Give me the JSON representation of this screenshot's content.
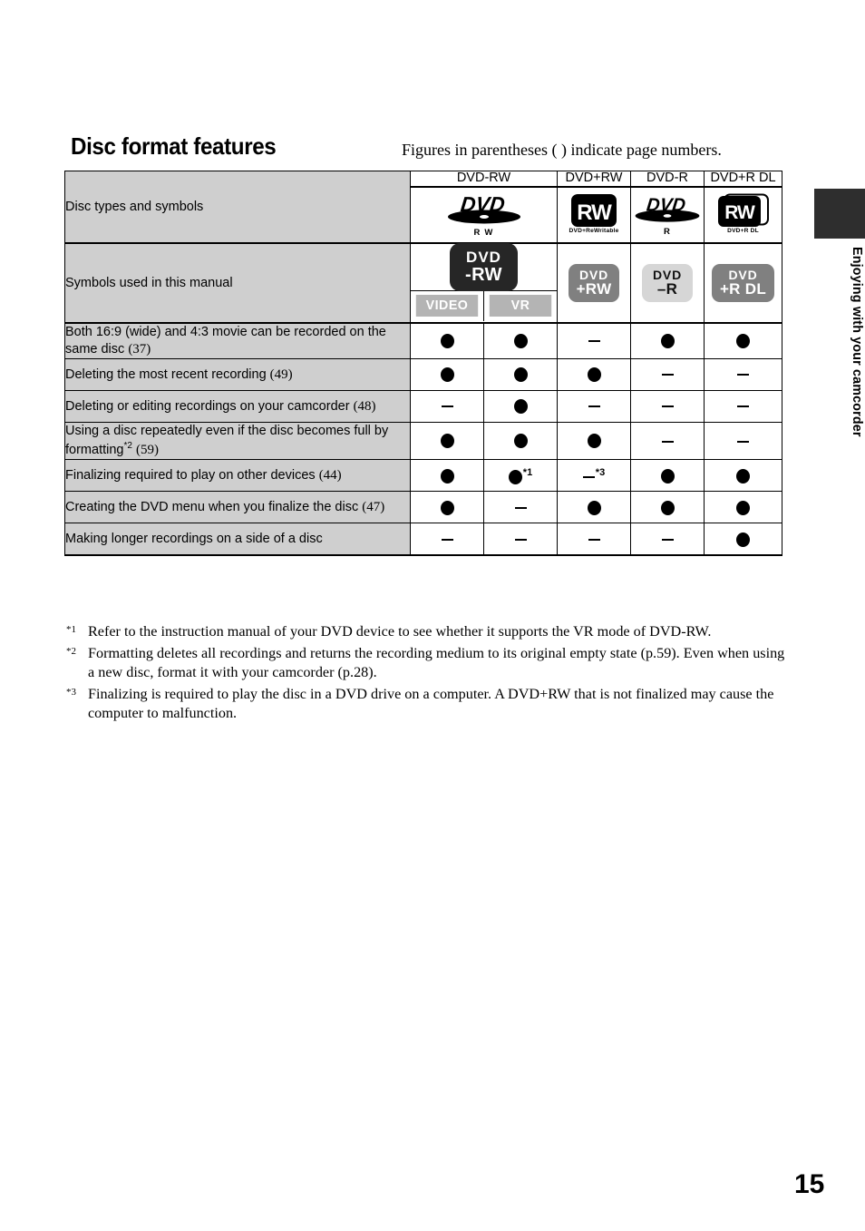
{
  "page": {
    "title": "Disc format features",
    "note": "Figures in parentheses ( ) indicate page numbers.",
    "number": "15",
    "side_tab_label": "Enjoying with your camcorder"
  },
  "table": {
    "row_label_disc_types": "Disc types and symbols",
    "row_label_symbols": "Symbols used in this manual",
    "columns": [
      {
        "header": "DVD-RW",
        "span": 2
      },
      {
        "header": "DVD+RW",
        "span": 1
      },
      {
        "header": "DVD-R",
        "span": 1
      },
      {
        "header": "DVD+R DL",
        "span": 1
      }
    ],
    "disc_logos": [
      {
        "name": "dvd-rw-logo",
        "mark": "DVD",
        "caption": "R W",
        "style": "disc"
      },
      {
        "name": "dvd-plus-rw-logo",
        "mark": "RW",
        "caption": "DVD+ReWritable",
        "style": "rw"
      },
      {
        "name": "dvd-r-logo",
        "mark": "DVD",
        "caption": "R",
        "style": "disc"
      },
      {
        "name": "dvd-plus-r-dl-logo",
        "mark": "RW",
        "caption": "DVD+R DL",
        "style": "rw-dl"
      }
    ],
    "manual_symbols": {
      "dvd_rw_badge": {
        "line1": "DVD",
        "line2": "-RW"
      },
      "dvd_rw_modes": [
        "VIDEO",
        "VR"
      ],
      "dvd_plus_rw_badge": {
        "line1": "DVD",
        "line2": "+RW"
      },
      "dvd_r_badge": {
        "line1": "DVD",
        "line2": "–R"
      },
      "dvd_plus_r_dl_badge": {
        "line1": "DVD",
        "line2": "+R DL"
      }
    },
    "feature_rows": [
      {
        "label": "Both 16:9 (wide) and 4:3 movie can be recorded on the same disc",
        "page": "(37)",
        "marks": [
          "dot",
          "dot",
          "dash",
          "dot",
          "dot"
        ],
        "refs": [
          "",
          "",
          "",
          "",
          ""
        ]
      },
      {
        "label": "Deleting the most recent recording",
        "page": "(49)",
        "marks": [
          "dot",
          "dot",
          "dot",
          "dash",
          "dash"
        ],
        "refs": [
          "",
          "",
          "",
          "",
          ""
        ]
      },
      {
        "label": "Deleting or editing recordings on your camcorder",
        "page": "(48)",
        "marks": [
          "dash",
          "dot",
          "dash",
          "dash",
          "dash"
        ],
        "refs": [
          "",
          "",
          "",
          "",
          ""
        ]
      },
      {
        "label": "Using a disc repeatedly even if the disc becomes full by formatting",
        "footnote": "*2",
        "page": "(59)",
        "marks": [
          "dot",
          "dot",
          "dot",
          "dash",
          "dash"
        ],
        "refs": [
          "",
          "",
          "",
          "",
          ""
        ]
      },
      {
        "label": "Finalizing required to play on other devices",
        "page": "(44)",
        "marks": [
          "dot",
          "dot",
          "dash",
          "dot",
          "dot"
        ],
        "refs": [
          "",
          "*1",
          "*3",
          "",
          ""
        ]
      },
      {
        "label": "Creating the DVD menu when you finalize the disc",
        "page": "(47)",
        "marks": [
          "dot",
          "dash",
          "dot",
          "dot",
          "dot"
        ],
        "refs": [
          "",
          "",
          "",
          "",
          ""
        ]
      },
      {
        "label": "Making longer recordings on a side of a disc",
        "page": "",
        "marks": [
          "dash",
          "dash",
          "dash",
          "dash",
          "dot"
        ],
        "refs": [
          "",
          "",
          "",
          "",
          ""
        ]
      }
    ]
  },
  "footnotes": [
    {
      "marker": "*1",
      "text": "Refer to the instruction manual of your DVD device to see whether it supports the VR mode of DVD-RW."
    },
    {
      "marker": "*2",
      "text": "Formatting deletes all recordings and returns the recording medium to its original empty state (p.59). Even when using a new disc, format it with your camcorder (p.28)."
    },
    {
      "marker": "*3",
      "text": "Finalizing is required to play the disc in a DVD drive on a computer. A DVD+RW that is not finalized may cause the computer to malfunction."
    }
  ]
}
